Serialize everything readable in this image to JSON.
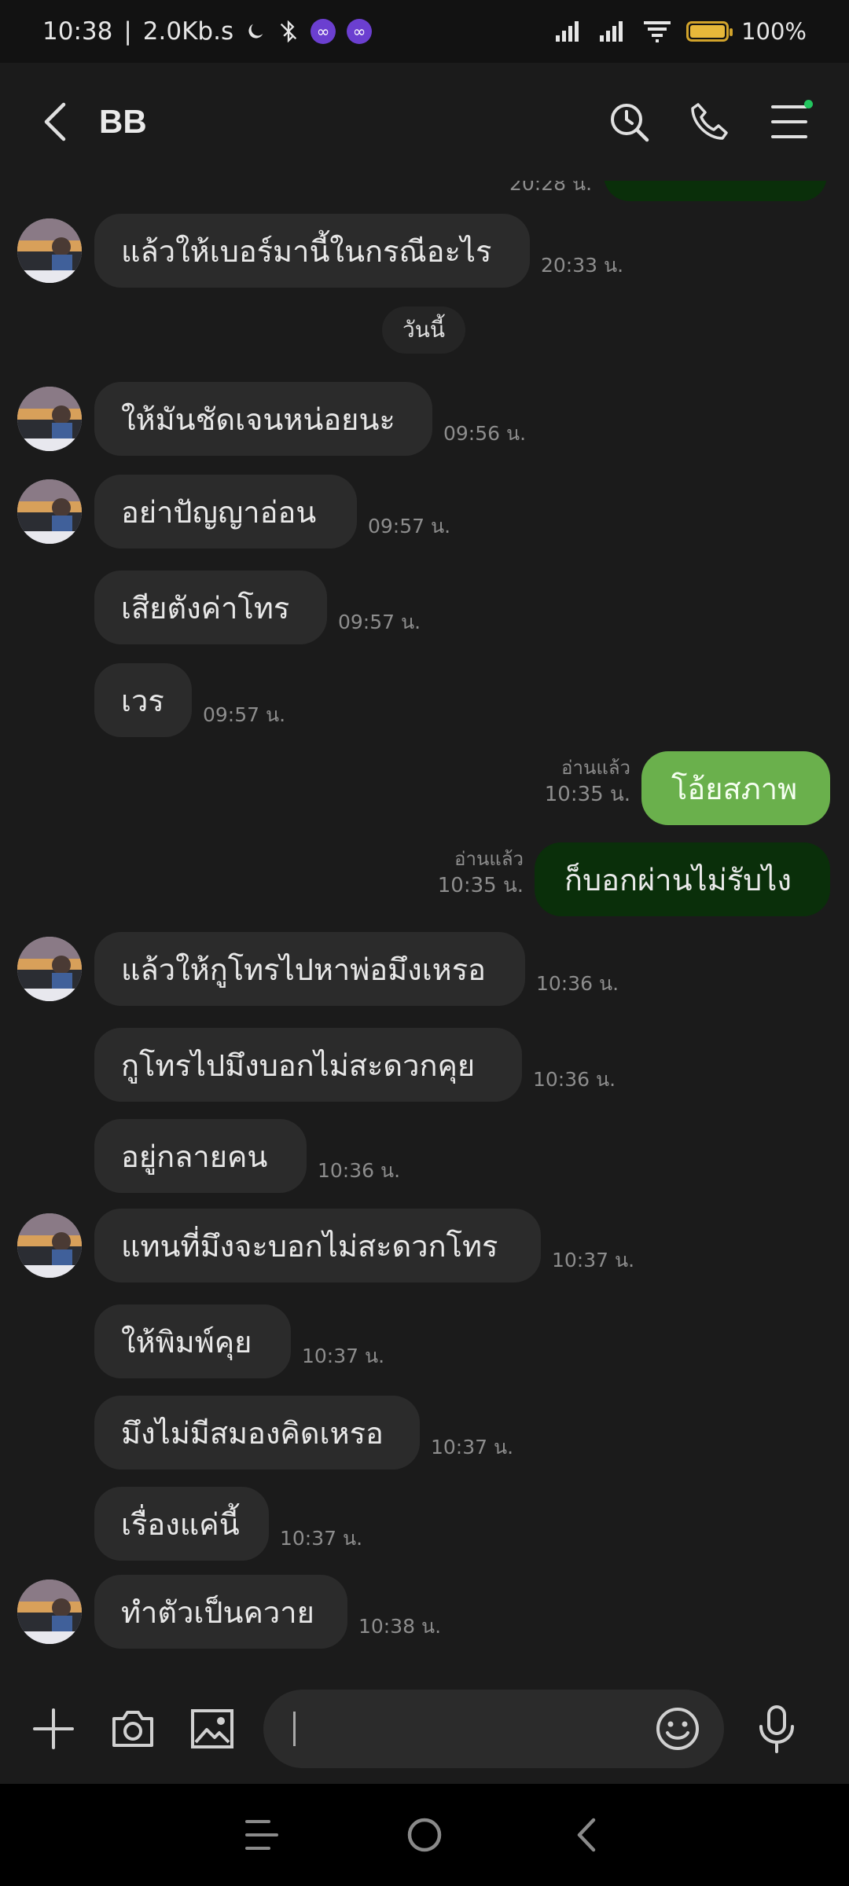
{
  "status_bar": {
    "time": "10:38",
    "separator": "|",
    "net_speed": "2.0Kb.s",
    "battery_level": 1.0,
    "battery_text": "100%",
    "icons": [
      "moon-icon",
      "bluetooth-icon",
      "app-badge-icon",
      "app-badge-icon",
      "signal-icon",
      "signal-icon",
      "wifi-icon",
      "battery-icon"
    ]
  },
  "header": {
    "title": "BB",
    "icons": [
      "back-icon",
      "search-icon",
      "phone-icon",
      "menu-icon"
    ]
  },
  "chat": {
    "prev_time": "20:28 น.",
    "prev_msg": {
      "text": "แล้วให้เบอร์มานี้ในกรณีอะไร",
      "time": "20:33 น."
    },
    "date_chip": "วันนี้",
    "messages": [
      {
        "text": "ให้มันชัดเจนหน่อยนะ",
        "time": "09:56 น."
      },
      {
        "text": "อย่าปัญญาอ่อน",
        "time": "09:57 น."
      },
      {
        "text": "เสียตังค่าโทร",
        "time": "09:57 น."
      },
      {
        "text": "เวร",
        "time": "09:57 น."
      },
      {
        "text": "โอ้ยสภาพ",
        "time": "10:35 น.",
        "read": "อ่านแล้ว"
      },
      {
        "text": "ก็บอกผ่านไม่รับไง",
        "time": "10:35 น.",
        "read": "อ่านแล้ว"
      },
      {
        "text": "แล้วให้กูโทรไปหาพ่อมึงเหรอ",
        "time": "10:36 น."
      },
      {
        "text": "กูโทรไปมึงบอกไม่สะดวกคุย",
        "time": "10:36 น."
      },
      {
        "text": "อยู่กลายคน",
        "time": "10:36 น."
      },
      {
        "text": "แทนที่มึงจะบอกไม่สะดวกโทร",
        "time": "10:37 น."
      },
      {
        "text": "ให้พิมพ์คุย",
        "time": "10:37 น."
      },
      {
        "text": "มึงไม่มีสมองคิดเหรอ",
        "time": "10:37 น."
      },
      {
        "text": "เรื่องแค่นี้",
        "time": "10:37 น."
      },
      {
        "text": "ทำตัวเป็นควาย",
        "time": "10:38 น."
      }
    ]
  },
  "input_bar": {
    "value": "",
    "icons": [
      "plus-icon",
      "camera-icon",
      "image-icon",
      "emoji-icon",
      "microphone-icon"
    ]
  },
  "nav_bar": {
    "icons": [
      "recents-icon",
      "home-icon",
      "back-nav-icon"
    ]
  },
  "colors": {
    "background": "#1b1b1b",
    "incoming_bubble": "#2b2b2b",
    "outgoing_light": "#6ab04c",
    "outgoing_dark": "#0a2f0a",
    "timestamp": "#8d8d8d"
  }
}
